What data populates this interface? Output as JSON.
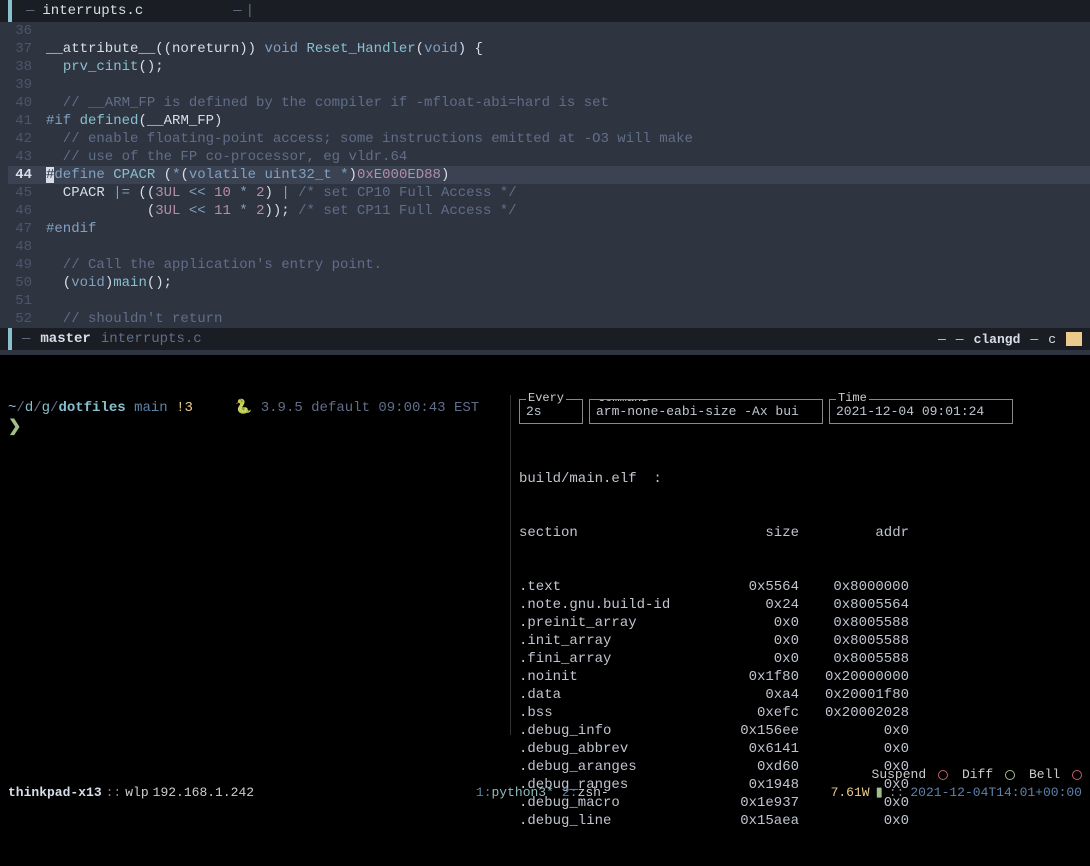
{
  "tab": {
    "filename": "interrupts.c",
    "dash": "—",
    "end_dash": "—"
  },
  "code": {
    "lines": [
      {
        "n": 36,
        "segs": []
      },
      {
        "n": 37,
        "segs": [
          {
            "t": "__attribute__",
            "c": "text"
          },
          {
            "t": "((noreturn)) ",
            "c": "text"
          },
          {
            "t": "void",
            "c": "kw"
          },
          {
            "t": " ",
            "c": "text"
          },
          {
            "t": "Reset_Handler",
            "c": "func"
          },
          {
            "t": "(",
            "c": "text"
          },
          {
            "t": "void",
            "c": "kw"
          },
          {
            "t": ") {",
            "c": "text"
          }
        ]
      },
      {
        "n": 38,
        "segs": [
          {
            "t": "  ",
            "c": "text"
          },
          {
            "t": "prv_cinit",
            "c": "func"
          },
          {
            "t": "();",
            "c": "text"
          }
        ]
      },
      {
        "n": 39,
        "segs": []
      },
      {
        "n": 40,
        "segs": [
          {
            "t": "  // __ARM_FP is defined by the compiler if -mfloat-abi=hard is set",
            "c": "comment"
          }
        ]
      },
      {
        "n": 41,
        "segs": [
          {
            "t": "#if",
            "c": "pp"
          },
          {
            "t": " ",
            "c": "text"
          },
          {
            "t": "defined",
            "c": "func"
          },
          {
            "t": "(__ARM_FP)",
            "c": "text"
          }
        ]
      },
      {
        "n": 42,
        "segs": [
          {
            "t": "  // enable floating-point access; some instructions emitted at -O3 will make",
            "c": "comment"
          }
        ]
      },
      {
        "n": 43,
        "segs": [
          {
            "t": "  // use of the FP co-processor, eg vldr.64",
            "c": "comment"
          }
        ]
      },
      {
        "n": 44,
        "cur": true,
        "segs": [
          {
            "t": "#",
            "c": "cursor-char"
          },
          {
            "t": "define",
            "c": "pp"
          },
          {
            "t": " ",
            "c": "text"
          },
          {
            "t": "CPACR",
            "c": "macro"
          },
          {
            "t": " (",
            "c": "text"
          },
          {
            "t": "*",
            "c": "op"
          },
          {
            "t": "(",
            "c": "text"
          },
          {
            "t": "volatile",
            "c": "kw"
          },
          {
            "t": " ",
            "c": "text"
          },
          {
            "t": "uint32_t",
            "c": "type"
          },
          {
            "t": " ",
            "c": "text"
          },
          {
            "t": "*",
            "c": "op"
          },
          {
            "t": ")",
            "c": "text"
          },
          {
            "t": "0xE000ED88",
            "c": "num"
          },
          {
            "t": ")",
            "c": "text"
          }
        ]
      },
      {
        "n": 45,
        "segs": [
          {
            "t": "  CPACR ",
            "c": "text"
          },
          {
            "t": "|=",
            "c": "op"
          },
          {
            "t": " ((",
            "c": "text"
          },
          {
            "t": "3UL",
            "c": "num"
          },
          {
            "t": " ",
            "c": "text"
          },
          {
            "t": "<<",
            "c": "op"
          },
          {
            "t": " ",
            "c": "text"
          },
          {
            "t": "10",
            "c": "num"
          },
          {
            "t": " ",
            "c": "text"
          },
          {
            "t": "*",
            "c": "op"
          },
          {
            "t": " ",
            "c": "text"
          },
          {
            "t": "2",
            "c": "num"
          },
          {
            "t": ") ",
            "c": "text"
          },
          {
            "t": "|",
            "c": "op"
          },
          {
            "t": " ",
            "c": "text"
          },
          {
            "t": "/* set CP10 Full Access */",
            "c": "comment"
          }
        ]
      },
      {
        "n": 46,
        "segs": [
          {
            "t": "            (",
            "c": "text"
          },
          {
            "t": "3UL",
            "c": "num"
          },
          {
            "t": " ",
            "c": "text"
          },
          {
            "t": "<<",
            "c": "op"
          },
          {
            "t": " ",
            "c": "text"
          },
          {
            "t": "11",
            "c": "num"
          },
          {
            "t": " ",
            "c": "text"
          },
          {
            "t": "*",
            "c": "op"
          },
          {
            "t": " ",
            "c": "text"
          },
          {
            "t": "2",
            "c": "num"
          },
          {
            "t": ")); ",
            "c": "text"
          },
          {
            "t": "/* set CP11 Full Access */",
            "c": "comment"
          }
        ]
      },
      {
        "n": 47,
        "segs": [
          {
            "t": "#endif",
            "c": "pp"
          }
        ]
      },
      {
        "n": 48,
        "segs": []
      },
      {
        "n": 49,
        "segs": [
          {
            "t": "  // Call the application's entry point.",
            "c": "comment"
          }
        ]
      },
      {
        "n": 50,
        "segs": [
          {
            "t": "  (",
            "c": "text"
          },
          {
            "t": "void",
            "c": "kw"
          },
          {
            "t": ")",
            "c": "text"
          },
          {
            "t": "main",
            "c": "func"
          },
          {
            "t": "();",
            "c": "text"
          }
        ]
      },
      {
        "n": 51,
        "segs": []
      },
      {
        "n": 52,
        "segs": [
          {
            "t": "  // shouldn't return",
            "c": "comment"
          }
        ]
      }
    ]
  },
  "status": {
    "branch": "master",
    "file": "interrupts.c",
    "dash": "—",
    "lsp": "clangd",
    "ft": "c"
  },
  "prompt": {
    "home": "~",
    "d1": "d",
    "d2": "g",
    "dir": "dotfiles",
    "branch": "main",
    "dirty": "!3",
    "snake": "🐍",
    "py": "3.9.5 default",
    "time": "09:00:43 EST",
    "char": "❯"
  },
  "watch": {
    "every_label": "Every",
    "every": "2s",
    "cmd_label": "Command",
    "cmd": "arm-none-eabi-size -Ax bui",
    "time_label": "Time",
    "time": "2021-12-04 09:01:24",
    "header": "build/main.elf  :",
    "colh": {
      "section": "section",
      "size": "size",
      "addr": "addr"
    },
    "rows": [
      {
        "s": ".text",
        "z": "0x5564",
        "a": "0x8000000"
      },
      {
        "s": ".note.gnu.build-id",
        "z": "0x24",
        "a": "0x8005564"
      },
      {
        "s": ".preinit_array",
        "z": "0x0",
        "a": "0x8005588"
      },
      {
        "s": ".init_array",
        "z": "0x0",
        "a": "0x8005588"
      },
      {
        "s": ".fini_array",
        "z": "0x0",
        "a": "0x8005588"
      },
      {
        "s": ".noinit",
        "z": "0x1f80",
        "a": "0x20000000"
      },
      {
        "s": ".data",
        "z": "0xa4",
        "a": "0x20001f80"
      },
      {
        "s": ".bss",
        "z": "0xefc",
        "a": "0x20002028"
      },
      {
        "s": ".debug_info",
        "z": "0x156ee",
        "a": "0x0"
      },
      {
        "s": ".debug_abbrev",
        "z": "0x6141",
        "a": "0x0"
      },
      {
        "s": ".debug_aranges",
        "z": "0xd60",
        "a": "0x0"
      },
      {
        "s": ".debug_ranges",
        "z": "0x1948",
        "a": "0x0"
      },
      {
        "s": ".debug_macro",
        "z": "0x1e937",
        "a": "0x0"
      },
      {
        "s": ".debug_line",
        "z": "0x15aea",
        "a": "0x0"
      }
    ],
    "footer": {
      "suspend": "Suspend",
      "diff": "Diff",
      "bell": "Bell"
    }
  },
  "tmux": {
    "host": "thinkpad-x13",
    "sep": "::",
    "iface": "wlp",
    "ip": "192.168.1.242",
    "win1_num": "1:",
    "win1": "python3*",
    "win2_num": "2:",
    "win2": "zsh-",
    "power": "7.61W",
    "battery": "▮",
    "time": "2021-12-04T14:01+00:00"
  }
}
